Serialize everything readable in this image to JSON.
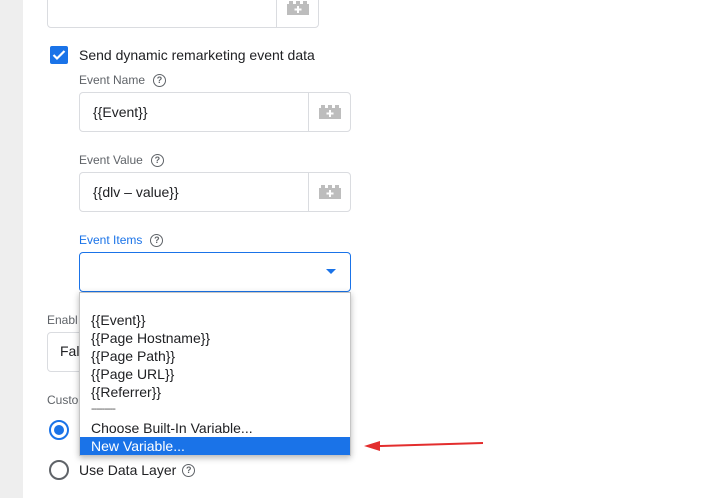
{
  "remarketing": {
    "checkbox_label": "Send dynamic remarketing event data",
    "checked": true
  },
  "event_name": {
    "label": "Event Name",
    "value": "{{Event}}"
  },
  "event_value": {
    "label": "Event Value",
    "value": "{{dlv – value}}"
  },
  "event_items": {
    "label": "Event Items",
    "value": ""
  },
  "dropdown": {
    "items": [
      "{{Event}}",
      "{{Page Hostname}}",
      "{{Page Path}}",
      "{{Page URL}}",
      "{{Referrer}}"
    ],
    "separator": "---------",
    "choose_builtin": "Choose Built-In Variable...",
    "new_variable": "New Variable..."
  },
  "behind": {
    "enable_label_partial": "Enabl",
    "enable_value_partial": "Fal",
    "custom_label_partial": "Custo"
  },
  "data_layer": {
    "label": "Use Data Layer"
  },
  "colors": {
    "accent": "#1a73e8",
    "arrow": "#e32d2d"
  }
}
